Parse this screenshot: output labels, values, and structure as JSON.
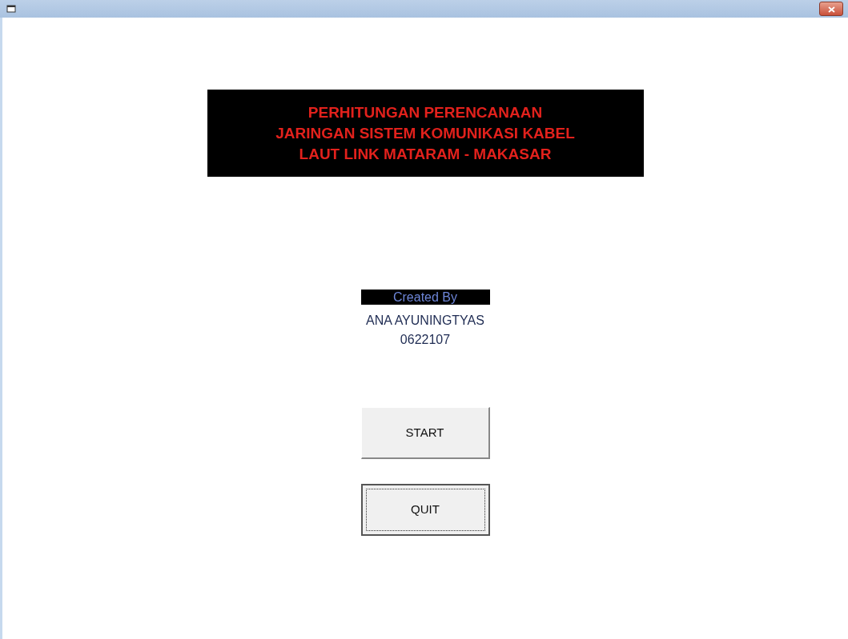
{
  "banner": {
    "lines": [
      "PERHITUNGAN PERENCANAAN",
      "JARINGAN SISTEM KOMUNIKASI KABEL",
      "LAUT LINK MATARAM - MAKASAR"
    ]
  },
  "credits": {
    "heading": "Created By",
    "name": "ANA AYUNINGTYAS",
    "id_number": "0622107"
  },
  "buttons": [
    {
      "label": "START",
      "focused": false
    },
    {
      "label": "QUIT",
      "focused": true
    }
  ]
}
